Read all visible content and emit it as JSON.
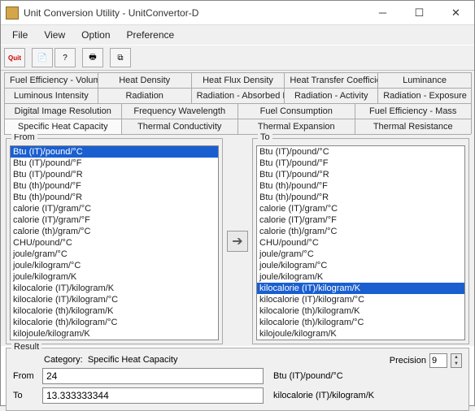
{
  "window": {
    "title": "Unit Conversion Utility - UnitConvertor-D"
  },
  "menu": {
    "file": "File",
    "view": "View",
    "option": "Option",
    "preference": "Preference"
  },
  "toolbar": {
    "quit": "Quit"
  },
  "tabs": {
    "row1": [
      "Fuel Efficiency - Volume",
      "Heat Density",
      "Heat Flux Density",
      "Heat Transfer Coefficient",
      "Luminance"
    ],
    "row2": [
      "Luminous Intensity",
      "Radiation",
      "Radiation - Absorbed Dose",
      "Radiation - Activity",
      "Radiation - Exposure"
    ],
    "row3": [
      "Digital Image Resolution",
      "Frequency Wavelength",
      "Fuel Consumption",
      "Fuel Efficiency - Mass"
    ],
    "row4": [
      "Specific Heat Capacity",
      "Thermal Conductivity",
      "Thermal Expansion",
      "Thermal Resistance"
    ]
  },
  "from": {
    "label": "From",
    "selected_index": 0,
    "items": [
      "Btu (IT)/pound/°C",
      "Btu (IT)/pound/°F",
      "Btu (IT)/pound/°R",
      "Btu (th)/pound/°F",
      "Btu (th)/pound/°R",
      "calorie (IT)/gram/°C",
      "calorie (IT)/gram/°F",
      "calorie (th)/gram/°C",
      "CHU/pound/°C",
      "joule/gram/°C",
      "joule/kilogram/°C",
      "joule/kilogram/K",
      "kilocalorie (IT)/kilogram/K",
      "kilocalorie (IT)/kilogram/°C",
      "kilocalorie (th)/kilogram/K",
      "kilocalorie (th)/kilogram/°C",
      "kilojoule/kilogram/K"
    ]
  },
  "to": {
    "label": "To",
    "selected_index": 12,
    "items": [
      "Btu (IT)/pound/°C",
      "Btu (IT)/pound/°F",
      "Btu (IT)/pound/°R",
      "Btu (th)/pound/°F",
      "Btu (th)/pound/°R",
      "calorie (IT)/gram/°C",
      "calorie (IT)/gram/°F",
      "calorie (th)/gram/°C",
      "CHU/pound/°C",
      "joule/gram/°C",
      "joule/kilogram/°C",
      "joule/kilogram/K",
      "kilocalorie (IT)/kilogram/K",
      "kilocalorie (IT)/kilogram/°C",
      "kilocalorie (th)/kilogram/K",
      "kilocalorie (th)/kilogram/°C",
      "kilojoule/kilogram/K"
    ]
  },
  "result": {
    "label": "Result",
    "category_label": "Category:",
    "category_value": "Specific Heat Capacity",
    "precision_label": "Precision",
    "precision_value": "9",
    "from_label": "From",
    "from_value": "24",
    "from_unit": "Btu (IT)/pound/°C",
    "to_label": "To",
    "to_value": "13.333333344",
    "to_unit": "kilocalorie (IT)/kilogram/K"
  }
}
